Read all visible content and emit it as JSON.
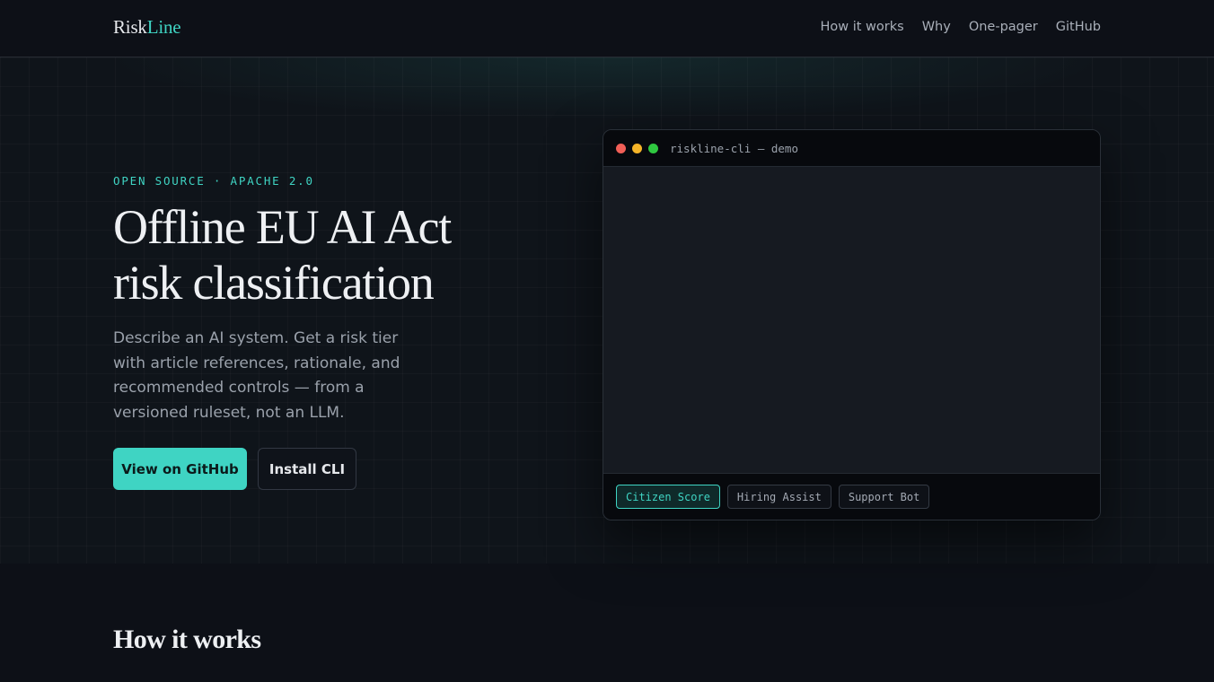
{
  "nav": {
    "logo_main": "Risk",
    "logo_accent": "Line",
    "links": [
      "How it works",
      "Why",
      "One-pager",
      "GitHub"
    ]
  },
  "hero": {
    "eyebrow": "OPEN SOURCE · APACHE 2.0",
    "headline": "Offline EU AI Act risk classification",
    "subtext": "Describe an AI system. Get a risk tier with article references, rationale, and recommended controls — from a versioned ruleset, not an LLM.",
    "primary_button": "View on GitHub",
    "secondary_button": "Install CLI"
  },
  "terminal": {
    "title": "riskline-cli — demo",
    "tabs": [
      {
        "label": "Citizen Score",
        "active": true
      },
      {
        "label": "Hiring Assist",
        "active": false
      },
      {
        "label": "Support Bot",
        "active": false
      }
    ]
  },
  "section": {
    "title": "How it works"
  },
  "colors": {
    "accent": "#3fd4c3",
    "background": "#0d1017"
  }
}
